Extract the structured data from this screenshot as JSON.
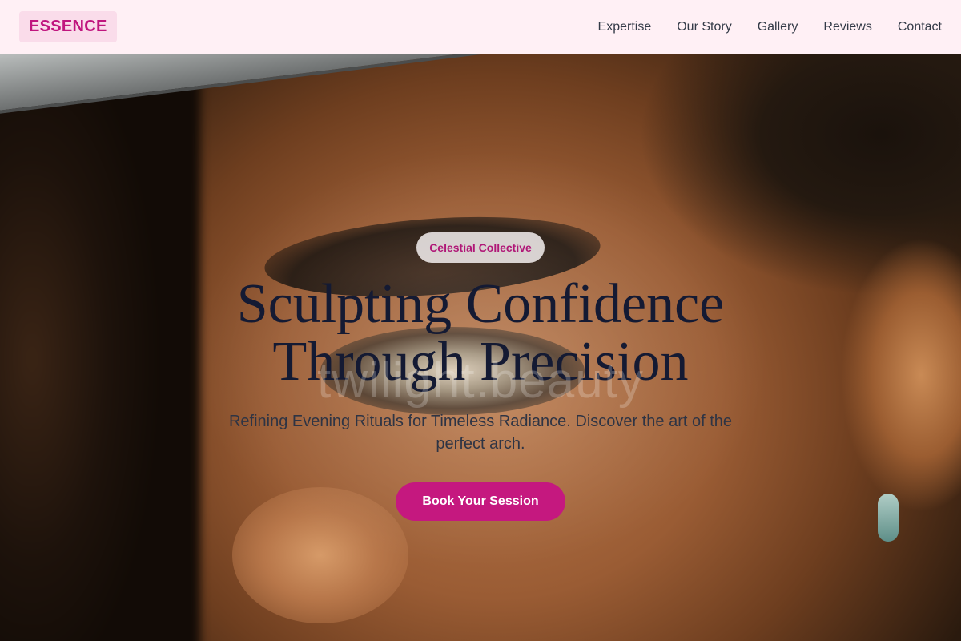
{
  "brand": {
    "logo_text": "ESSENCE",
    "accent_color": "#c5187f"
  },
  "nav": {
    "items": [
      {
        "label": "Expertise"
      },
      {
        "label": "Our Story"
      },
      {
        "label": "Gallery"
      },
      {
        "label": "Reviews"
      },
      {
        "label": "Contact"
      }
    ]
  },
  "hero": {
    "badge": "Celestial Collective",
    "headline_line1": "Sculpting Confidence",
    "headline_line2": "Through Precision",
    "watermark": "twilight.beauty",
    "subtitle": "Refining Evening Rituals for Timeless Radiance. Discover the art of the perfect arch.",
    "cta_label": "Book Your Session"
  }
}
